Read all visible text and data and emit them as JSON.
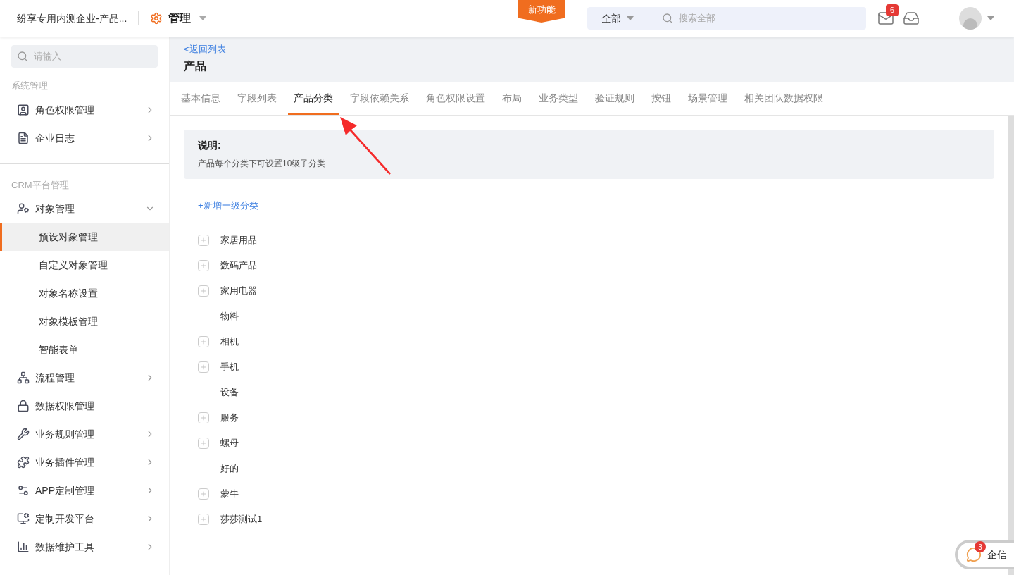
{
  "topbar": {
    "company": "纷享专用内测企业-产品...",
    "app_title": "管理",
    "new_feature": "新功能",
    "scope": "全部",
    "search": {
      "placeholder": "搜索全部"
    },
    "mail_badge": "6"
  },
  "sidebar": {
    "search": {
      "placeholder": "请输入"
    },
    "sections": [
      {
        "title": "系统管理",
        "items": [
          {
            "label": "角色权限管理",
            "kind": "group",
            "expanded": false
          },
          {
            "label": "企业日志",
            "kind": "group",
            "expanded": false
          }
        ]
      },
      {
        "title": "CRM平台管理",
        "items": [
          {
            "label": "对象管理",
            "kind": "group",
            "expanded": true,
            "children": [
              {
                "label": "预设对象管理",
                "selected": true
              },
              {
                "label": "自定义对象管理",
                "selected": false
              },
              {
                "label": "对象名称设置",
                "selected": false
              },
              {
                "label": "对象模板管理",
                "selected": false
              },
              {
                "label": "智能表单",
                "selected": false
              }
            ]
          },
          {
            "label": "流程管理",
            "kind": "group",
            "expanded": false
          },
          {
            "label": "数据权限管理",
            "kind": "link"
          },
          {
            "label": "业务规则管理",
            "kind": "group",
            "expanded": false
          },
          {
            "label": "业务插件管理",
            "kind": "group",
            "expanded": false
          },
          {
            "label": "APP定制管理",
            "kind": "group",
            "expanded": false
          },
          {
            "label": "定制开发平台",
            "kind": "group",
            "expanded": false
          },
          {
            "label": "数据维护工具",
            "kind": "group",
            "expanded": false
          }
        ]
      }
    ]
  },
  "page": {
    "back_link": "<返回列表",
    "title": "产品",
    "tabs": [
      {
        "label": "基本信息",
        "selected": false
      },
      {
        "label": "字段列表",
        "selected": false
      },
      {
        "label": "产品分类",
        "selected": true
      },
      {
        "label": "字段依赖关系",
        "selected": false
      },
      {
        "label": "角色权限设置",
        "selected": false
      },
      {
        "label": "布局",
        "selected": false
      },
      {
        "label": "业务类型",
        "selected": false
      },
      {
        "label": "验证规则",
        "selected": false
      },
      {
        "label": "按钮",
        "selected": false
      },
      {
        "label": "场景管理",
        "selected": false
      },
      {
        "label": "相关团队数据权限",
        "selected": false
      }
    ],
    "notice": {
      "title": "说明:",
      "text": "产品每个分类下可设置10级子分类"
    },
    "add_link": "+新增一级分类",
    "categories": [
      {
        "label": "家居用品",
        "expandable": true
      },
      {
        "label": "数码产品",
        "expandable": true
      },
      {
        "label": "家用电器",
        "expandable": true
      },
      {
        "label": "物料",
        "expandable": false
      },
      {
        "label": "相机",
        "expandable": true
      },
      {
        "label": "手机",
        "expandable": true
      },
      {
        "label": "设备",
        "expandable": false
      },
      {
        "label": "服务",
        "expandable": true
      },
      {
        "label": "螺母",
        "expandable": true
      },
      {
        "label": "好的",
        "expandable": false
      },
      {
        "label": "蒙牛",
        "expandable": true
      },
      {
        "label": "莎莎测试1",
        "expandable": true
      }
    ]
  },
  "chat": {
    "label": "企信",
    "badge": "3"
  }
}
